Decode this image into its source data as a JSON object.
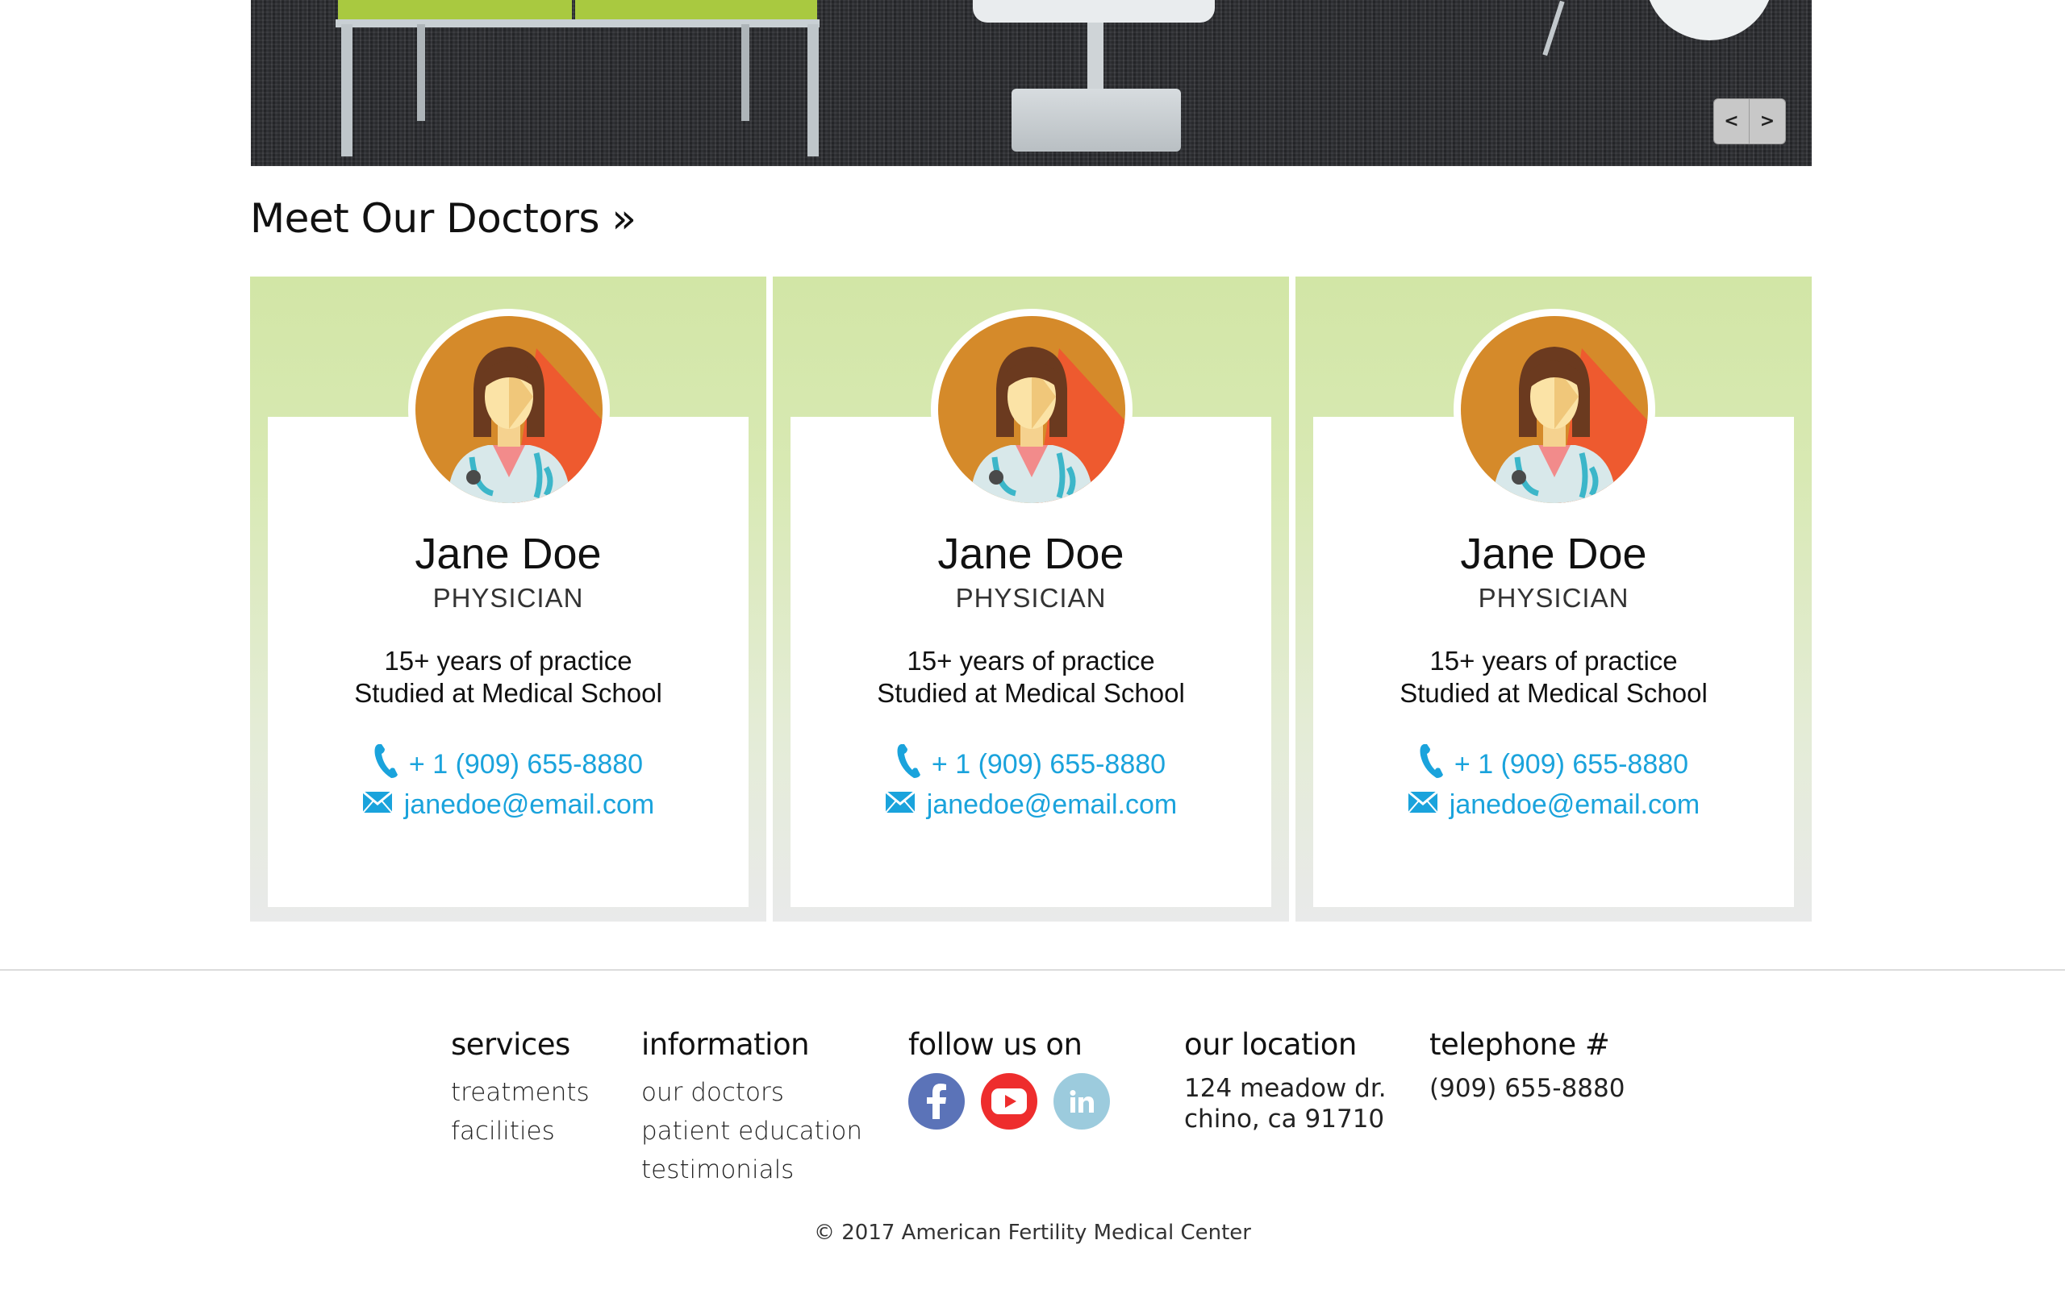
{
  "hero": {
    "prev_label": "<",
    "next_label": ">"
  },
  "section": {
    "title": "Meet Our Doctors »"
  },
  "doctors": [
    {
      "name": "Jane Doe",
      "role": "PHYSICIAN",
      "line1": "15+ years of practice",
      "line2": "Studied at Medical School",
      "phone": "+ 1 (909) 655-8880",
      "email": "janedoe@email.com"
    },
    {
      "name": "Jane Doe",
      "role": "PHYSICIAN",
      "line1": "15+ years of practice",
      "line2": "Studied at Medical School",
      "phone": "+ 1 (909) 655-8880",
      "email": "janedoe@email.com"
    },
    {
      "name": "Jane Doe",
      "role": "PHYSICIAN",
      "line1": "15+ years of practice",
      "line2": "Studied at Medical School",
      "phone": "+ 1 (909) 655-8880",
      "email": "janedoe@email.com"
    }
  ],
  "footer": {
    "services": {
      "heading": "services",
      "items": [
        "treatments",
        "facilities"
      ]
    },
    "information": {
      "heading": "information",
      "items": [
        "our doctors",
        "patient education",
        "testimonials"
      ]
    },
    "follow": {
      "heading": "follow us on",
      "icons": [
        "facebook-icon",
        "youtube-icon",
        "linkedin-icon"
      ]
    },
    "location": {
      "heading": "our location",
      "line1": "124 meadow dr.",
      "line2": "chino, ca 91710"
    },
    "telephone": {
      "heading": "telephone #",
      "number": "(909) 655-8880"
    },
    "copyright": "© 2017 American Fertility Medical Center"
  },
  "colors": {
    "accent_link": "#1aa3dc",
    "card_gradient_top": "#d2e6a6",
    "facebook": "#5b73b8",
    "youtube": "#ee2d2d",
    "linkedin": "#9ccbdd"
  }
}
